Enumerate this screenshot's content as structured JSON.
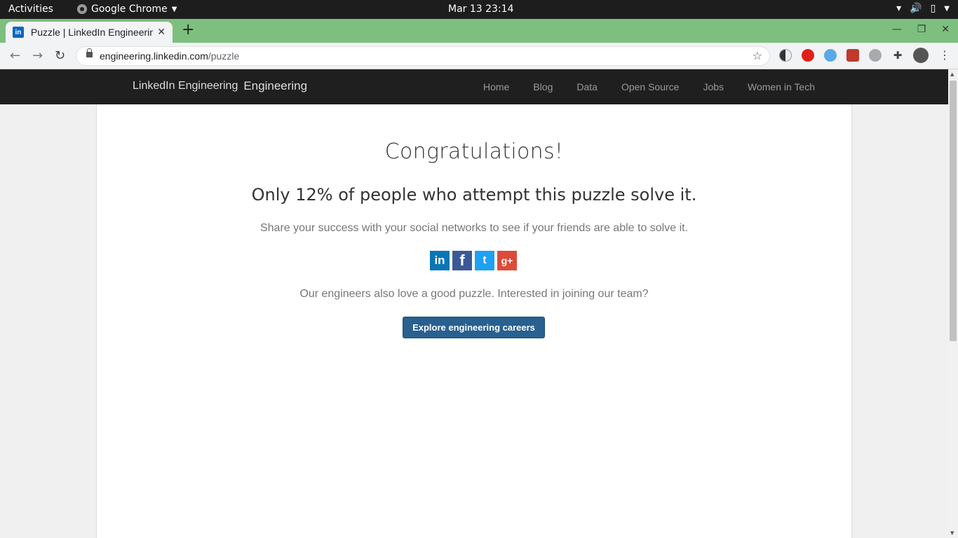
{
  "system_bar": {
    "activities": "Activities",
    "app_name": "Google Chrome",
    "clock": "Mar 13  23:14"
  },
  "browser": {
    "tab_title": "Puzzle | LinkedIn Engineering",
    "tab_favicon": "in",
    "url_host": "engineering.linkedin.com",
    "url_path": "/puzzle"
  },
  "site_nav": {
    "logo_alt": "LinkedIn Engineering",
    "brand": "Engineering",
    "links": [
      "Home",
      "Blog",
      "Data",
      "Open Source",
      "Jobs",
      "Women in Tech"
    ]
  },
  "main": {
    "heading": "Congratulations!",
    "subheading": "Only 12% of people who attempt this puzzle solve it.",
    "share_text": "Share your success with your social networks to see if your friends are able to solve it.",
    "social": {
      "linkedin": "in",
      "facebook": "f",
      "twitter": "t",
      "googleplus": "g+"
    },
    "invite_text": "Our engineers also love a good puzzle. Interested in joining our team?",
    "cta_label": "Explore engineering careers"
  },
  "colors": {
    "tabstrip": "#7dbf7e",
    "site_nav_bg": "#1f1f1f",
    "cta_bg": "#286090",
    "linkedin": "#0976b4",
    "facebook": "#3b5998",
    "twitter": "#1da1f2",
    "googleplus": "#dd4b39"
  }
}
